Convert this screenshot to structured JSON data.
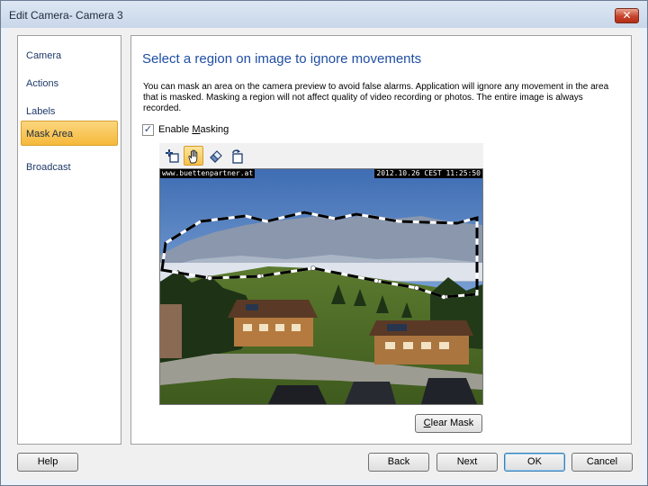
{
  "window": {
    "title": "Edit Camera- Camera 3",
    "close_label": "✕"
  },
  "sidebar": {
    "items": [
      {
        "label": "Camera",
        "active": false
      },
      {
        "label": "Actions",
        "active": false
      },
      {
        "label": "Labels",
        "active": false
      },
      {
        "label": "Mask Area",
        "active": true
      },
      {
        "label": "Broadcast",
        "active": false
      }
    ]
  },
  "main": {
    "heading": "Select a region on image to ignore movements",
    "description": "You can mask an area on the camera preview to avoid false alarms. Application will ignore any movement in the area that is masked. Masking a region will not affect quality of video recording or photos. The entire image is always recorded.",
    "enable_masking": {
      "checked": true,
      "check_glyph": "✓",
      "label_pre": "Enable ",
      "label_mnemonic": "M",
      "label_post": "asking"
    },
    "toolbar": [
      {
        "icon": "add-point-icon",
        "active": false
      },
      {
        "icon": "hand-pan-icon",
        "active": true
      },
      {
        "icon": "eraser-icon",
        "active": false
      },
      {
        "icon": "rotate-icon",
        "active": false
      }
    ],
    "preview": {
      "osd_left": "www.buettenpartner.at",
      "osd_right": "2012.10.26 CEST 11:25:50"
    },
    "clear_mask": {
      "mnemonic": "C",
      "rest": "lear Mask"
    }
  },
  "footer": {
    "help": "Help",
    "back": "Back",
    "next": "Next",
    "ok": "OK",
    "cancel": "Cancel"
  },
  "colors": {
    "accent_heading": "#1f4ea3",
    "active_nav": "#f5b93a",
    "titlebar": "#c9d7ea"
  }
}
